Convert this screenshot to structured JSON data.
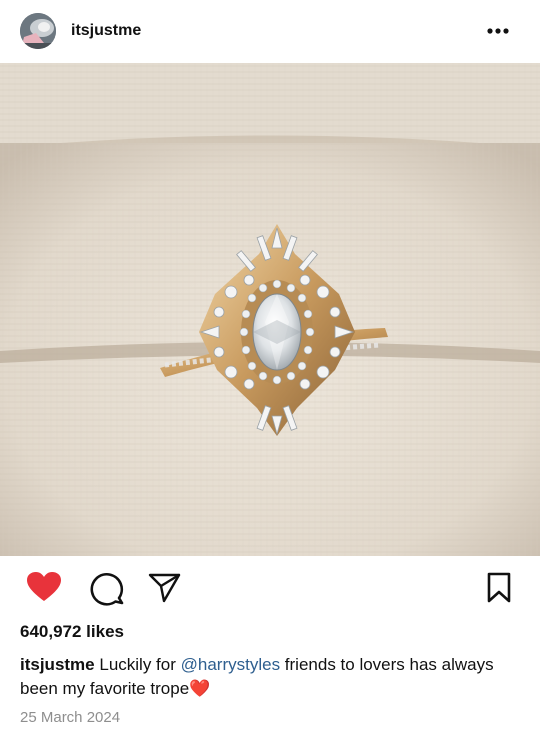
{
  "post": {
    "username": "itsjustme",
    "likes": "640,972 likes",
    "caption_user": "itsjustme",
    "caption_pre": " Luckily for ",
    "caption_mention": "@harrystyles",
    "caption_post": " friends to lovers has always been my favorite trope",
    "caption_emoji": "❤️",
    "date": "25 March 2024"
  },
  "icons": {
    "more": "more-horizontal-icon",
    "like": "heart-filled-icon",
    "comment": "comment-icon",
    "share": "paper-plane-icon",
    "save": "bookmark-icon"
  },
  "colors": {
    "like_red": "#e8333b",
    "mention_blue": "#2f5f8f",
    "date_gray": "#8e8e8e"
  }
}
